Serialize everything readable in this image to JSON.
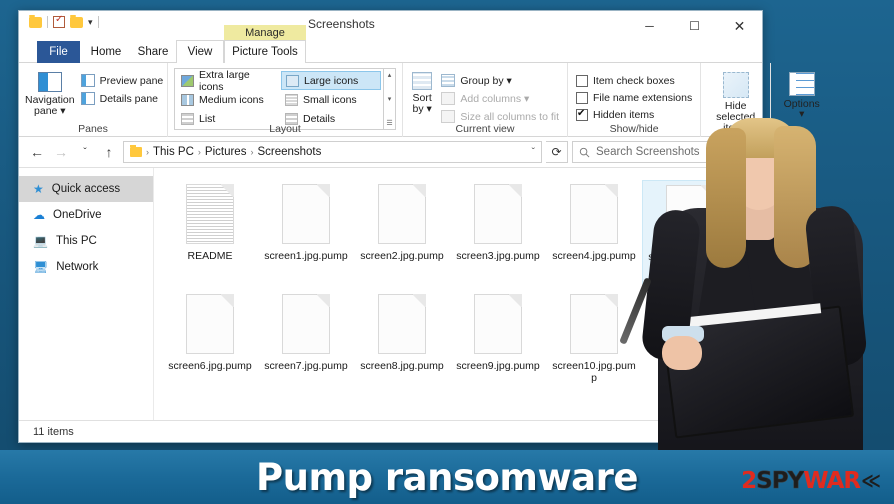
{
  "banner": {
    "title": "Pump ransomware",
    "logo": {
      "part1": "2",
      "part2": "SPY",
      "part3": "WAR",
      "mark": "≪"
    }
  },
  "window": {
    "title": "Screenshots",
    "quick_access": {
      "folder_icon": "folder-icon",
      "properties_icon": "properties-icon",
      "new_folder_icon": "new-folder-icon",
      "customize_arrow": "▾"
    },
    "controls": {
      "minimize": "─",
      "maximize": "☐",
      "close": "✕",
      "ribbon_collapse": "⌃",
      "help": "?"
    }
  },
  "ribbon": {
    "context_header": "Manage",
    "tabs": [
      {
        "label": "File"
      },
      {
        "label": "Home"
      },
      {
        "label": "Share"
      },
      {
        "label": "View"
      },
      {
        "label": "Picture Tools"
      }
    ],
    "groups": {
      "panes": {
        "label": "Panes",
        "navigation_pane": "Navigation\npane",
        "navigation_pane_line1": "Navigation",
        "navigation_pane_line2": "pane ▾",
        "preview_pane": "Preview pane",
        "details_pane": "Details pane"
      },
      "layout": {
        "label": "Layout",
        "options": [
          {
            "label": "Extra large icons",
            "selected": false
          },
          {
            "label": "Large icons",
            "selected": true
          },
          {
            "label": "Medium icons",
            "selected": false
          },
          {
            "label": "Small icons",
            "selected": false
          },
          {
            "label": "List",
            "selected": false
          },
          {
            "label": "Details",
            "selected": false
          }
        ],
        "scroll_up": "▴",
        "scroll_down": "▾",
        "scroll_more": "☰"
      },
      "current_view": {
        "label": "Current view",
        "sort_by_line1": "Sort",
        "sort_by_line2": "by ▾",
        "group_by": "Group by ▾",
        "add_columns": "Add columns ▾",
        "size_all_columns": "Size all columns to fit"
      },
      "show_hide": {
        "label": "Show/hide",
        "item_check_boxes": "Item check boxes",
        "item_check_boxes_checked": false,
        "file_name_extensions": "File name extensions",
        "file_name_extensions_checked": false,
        "hidden_items": "Hidden items",
        "hidden_items_checked": true,
        "hide_selected_line1": "Hide selected",
        "hide_selected_line2": "items",
        "options_label": "Options",
        "options_arrow": "▾"
      }
    }
  },
  "address_bar": {
    "back": "←",
    "forward": "→",
    "recent": "ˇ",
    "up": "↑",
    "breadcrumb": [
      "This PC",
      "Pictures",
      "Screenshots"
    ],
    "separator": "›",
    "dropdown": "ˇ",
    "refresh": "⟳",
    "search_placeholder": "Search Screenshots",
    "search_value": ""
  },
  "sidebar": {
    "items": [
      {
        "label": "Quick access",
        "icon": "star-icon",
        "selected": true
      },
      {
        "label": "OneDrive",
        "icon": "cloud-icon",
        "selected": false
      },
      {
        "label": "This PC",
        "icon": "monitor-icon",
        "selected": false
      },
      {
        "label": "Network",
        "icon": "network-icon",
        "selected": false
      }
    ]
  },
  "files": [
    {
      "name": "README",
      "type": "text-document",
      "selected": false
    },
    {
      "name": "screen1.jpg.pump",
      "type": "blank-document",
      "selected": false
    },
    {
      "name": "screen2.jpg.pump",
      "type": "blank-document",
      "selected": false
    },
    {
      "name": "screen3.jpg.pump",
      "type": "blank-document",
      "selected": false
    },
    {
      "name": "screen4.jpg.pump",
      "type": "blank-document",
      "selected": false
    },
    {
      "name": "screen5.jpg.pump",
      "type": "blank-document",
      "selected": true
    },
    {
      "name": "screen6.jpg.pump",
      "type": "blank-document",
      "selected": false
    },
    {
      "name": "screen7.jpg.pump",
      "type": "blank-document",
      "selected": false
    },
    {
      "name": "screen8.jpg.pump",
      "type": "blank-document",
      "selected": false
    },
    {
      "name": "screen9.jpg.pump",
      "type": "blank-document",
      "selected": false
    },
    {
      "name": "screen10.jpg.pump",
      "type": "blank-document",
      "selected": false
    }
  ],
  "status_bar": {
    "item_count": "11 items"
  },
  "colors": {
    "background": "#1a5c82",
    "accent": "#0078d7",
    "context_tab": "#efeaa0",
    "file_tab": "#2b5797",
    "selection": "#cce6f7",
    "logo_red": "#e02b1f"
  }
}
